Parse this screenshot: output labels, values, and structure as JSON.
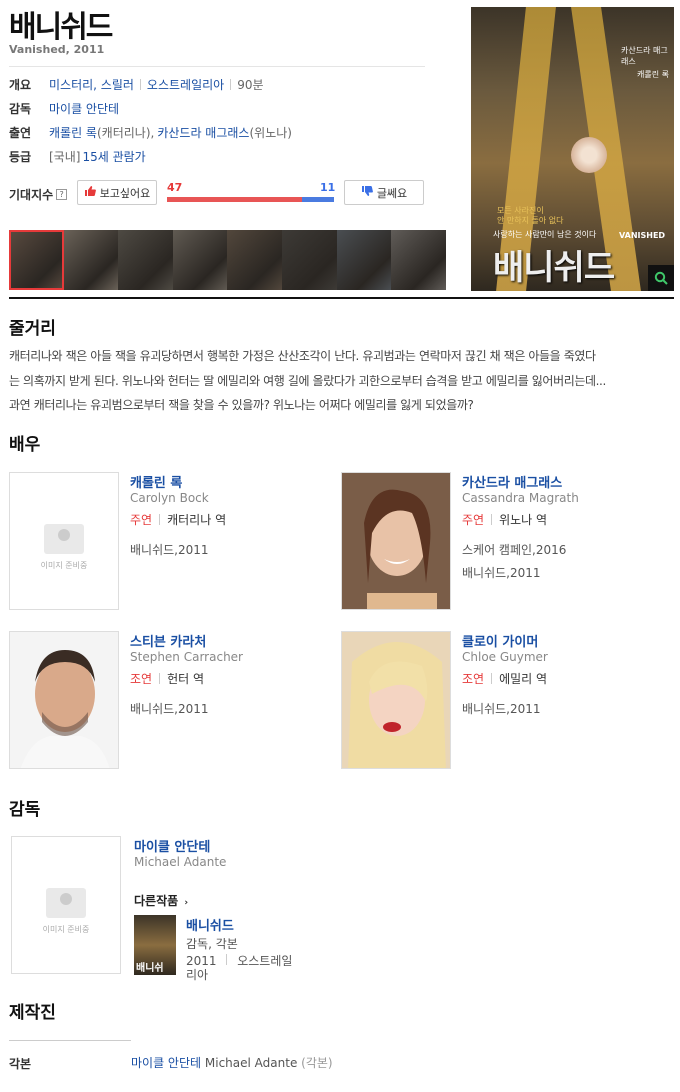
{
  "movie": {
    "title": "배니쉬드",
    "subtitle": "Vanished, 2011",
    "info": {
      "overview_label": "개요",
      "genre": "미스터리, 스릴러",
      "country": "오스트레일리아",
      "runtime": "90분",
      "director_label": "감독",
      "director": "마이클 안단테",
      "cast_label": "출연",
      "cast1_name": "캐롤린 록",
      "cast1_role": "(캐터리나),",
      "cast2_name": "카산드라 매그래스",
      "cast2_role": "(위노나)",
      "rating_label": "등급",
      "rating_domestic": "[국내]",
      "rating": "15세 관람가"
    },
    "expectation": {
      "label": "기대지수",
      "help": "?",
      "like_label": "보고싶어요",
      "dislike_label": "글쎄요",
      "like_count": "47",
      "dislike_count": "11",
      "like_ratio": 0.81
    },
    "poster": {
      "title": "배니쉬드",
      "title_en": "VANISHED",
      "credit1": "카산드라 매그래스",
      "credit2": "캐롤린 록",
      "tagline1": "모든 사라진이",
      "tagline2": "안 만하지 돌아 없다",
      "tagline3": "사랑하는 사람만이 남은 것이다",
      "zoom_icon": "search-icon"
    },
    "stills": [
      "#5a4b40",
      "#6a6258",
      "#4e4a43",
      "#605a52",
      "#52473c",
      "#3d3a36",
      "#4a4e52",
      "#605c58"
    ]
  },
  "synopsis": {
    "heading": "줄거리",
    "lines": [
      "캐터리나와 잭은 아들 잭을 유괴당하면서 행복한 가정은 산산조각이 난다. 유괴범과는 연락마저 끊긴 채 잭은 아들을 죽였다",
      "는 의혹까지 받게 된다. 위노나와 헌터는 딸 에밀리와 여행 길에 올랐다가 괴한으로부터 습격을 받고 에밀리를 잃어버리는데...",
      "과연 캐터리나는 유괴범으로부터 잭을 찾을 수 있을까? 위노나는 어쩌다 에밀리를 잃게 되었을까?"
    ]
  },
  "cast": {
    "heading": "배우",
    "members": [
      {
        "name": "캐롤린 록",
        "name_en": "Carolyn Bock",
        "role_type": "주연",
        "role": "캐터리나 역",
        "works": [
          "배니쉬드,2011"
        ],
        "photo": "none"
      },
      {
        "name": "카산드라 매그래스",
        "name_en": "Cassandra Magrath",
        "role_type": "주연",
        "role": "위노나 역",
        "works": [
          "스케어 캠페인,2016",
          "배니쉬드,2011"
        ],
        "photo": "woman-brunette"
      },
      {
        "name": "스티븐 카라처",
        "name_en": "Stephen Carracher",
        "role_type": "조연",
        "role": "헌터 역",
        "works": [
          "배니쉬드,2011"
        ],
        "photo": "man"
      },
      {
        "name": "클로이 가이머",
        "name_en": "Chloe Guymer",
        "role_type": "조연",
        "role": "에밀리 역",
        "works": [
          "배니쉬드,2011"
        ],
        "photo": "woman-blonde"
      }
    ],
    "placeholder_text": "이미지 준비중"
  },
  "director": {
    "heading": "감독",
    "name": "마이클 안단테",
    "name_en": "Michael Adante",
    "placeholder_text": "이미지 준비중",
    "other_works_label": "다른작품",
    "work": {
      "title": "배니쉬드",
      "role": "감독, 각본",
      "year": "2011",
      "country": "오스트레일리아",
      "poster_text": "배니쉬"
    }
  },
  "staff": {
    "heading": "제작진",
    "rows": [
      {
        "label": "각본",
        "name": "마이클 안단테",
        "name_en": "Michael Adante",
        "role": "(각본)"
      }
    ]
  }
}
